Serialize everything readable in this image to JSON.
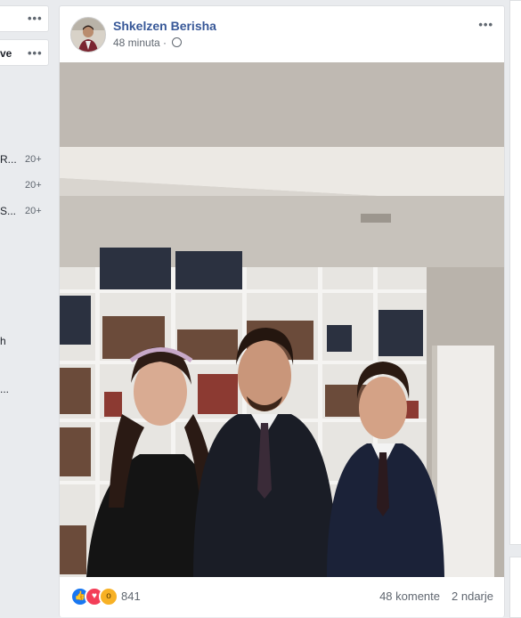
{
  "sidebar": {
    "top_card_label": "",
    "second_card_label": "ve",
    "rows": [
      {
        "label": "R...",
        "count": "20+"
      },
      {
        "label": "",
        "count": "20+"
      },
      {
        "label": "S...",
        "count": "20+"
      }
    ],
    "fragment_1": "h",
    "fragment_2": "..."
  },
  "post": {
    "author": "Shkelzen Berisha",
    "time": "48 minuta",
    "separator": "·",
    "photo_icon": "family-portrait-photo",
    "reactions": {
      "icons": [
        "like-icon",
        "love-icon",
        "wow-icon"
      ],
      "count": "841"
    },
    "comments": "48 komente",
    "shares": "2 ndarje"
  },
  "colors": {
    "author_link": "#385898",
    "like": "#1877f2",
    "love": "#f33e58",
    "wow": "#f7b125"
  }
}
